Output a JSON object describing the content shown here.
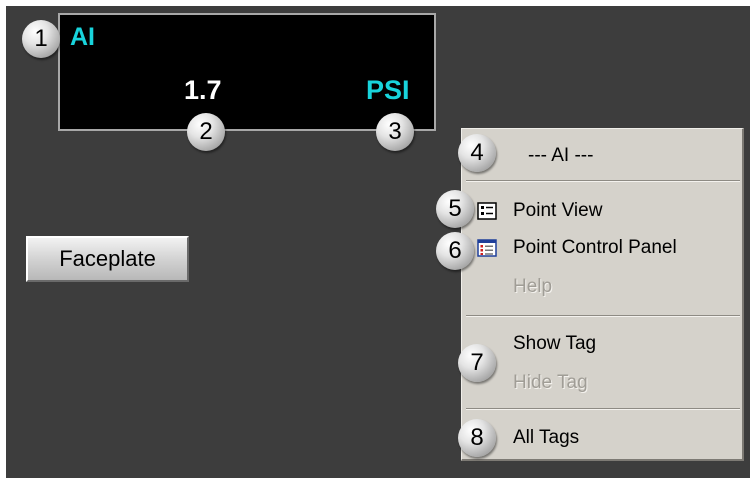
{
  "display": {
    "tag": "AI",
    "value": "1.7",
    "units": "PSI"
  },
  "faceplate_button": {
    "label": "Faceplate"
  },
  "context_menu": {
    "title": "--- AI ---",
    "items": [
      {
        "label": "Point View",
        "icon": "point-view-icon",
        "enabled": true
      },
      {
        "label": "Point Control Panel",
        "icon": "point-control-panel-icon",
        "enabled": true
      },
      {
        "label": "Help",
        "enabled": false
      },
      {
        "label": "Show Tag",
        "enabled": true
      },
      {
        "label": "Hide Tag",
        "enabled": false
      },
      {
        "label": "All Tags",
        "enabled": true
      }
    ]
  },
  "callouts": [
    "1",
    "2",
    "3",
    "4",
    "5",
    "6",
    "7",
    "8"
  ],
  "colors": {
    "background": "#3d3d3d",
    "display_bg": "#000000",
    "tag_text": "#18d4dc",
    "value_text": "#ffffff",
    "menu_bg": "#d5d2cb",
    "disabled_text": "#a09d96"
  }
}
